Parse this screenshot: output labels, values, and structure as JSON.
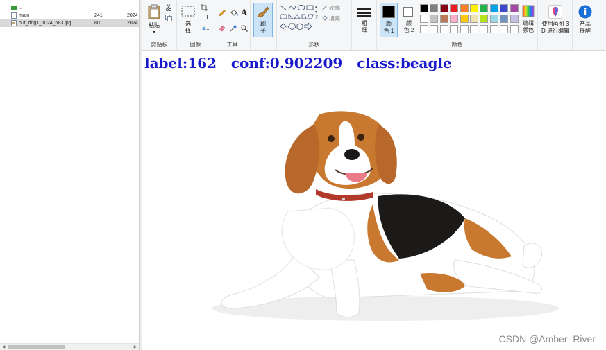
{
  "file_list": {
    "rows": [
      {
        "name": "..",
        "size": "",
        "date": ""
      },
      {
        "name": "main",
        "size": "241",
        "date": "2024"
      },
      {
        "name": "out_dog1_1024_683.jpg",
        "size": "80",
        "date": "2024"
      }
    ]
  },
  "ribbon": {
    "clipboard": {
      "label": "剪贴板",
      "paste": "粘贴"
    },
    "image": {
      "label": "图像",
      "select": "选\n择"
    },
    "tools": {
      "label": "工具"
    },
    "brush": {
      "label": "刷\n子"
    },
    "shapes": {
      "label": "形状",
      "outline": "轮廓",
      "fill": "填充"
    },
    "size": {
      "label": "粗\n细"
    },
    "colors": {
      "label": "颜色",
      "color1_label": "颜\n色 1",
      "color2_label": "颜\n色 2",
      "color1": "#000000",
      "color2": "#ffffff",
      "edit_label": "编辑\n颜色",
      "palette_row1": [
        "#000000",
        "#7f7f7f",
        "#880015",
        "#ed1c24",
        "#ff7f27",
        "#fff200",
        "#22b14c",
        "#00a2e8",
        "#3f48cc",
        "#a349a4"
      ],
      "palette_row2": [
        "#ffffff",
        "#c3c3c3",
        "#b97a57",
        "#ffaec9",
        "#ffc90e",
        "#efe4b0",
        "#b5e61d",
        "#99d9ea",
        "#7092be",
        "#c8bfe7"
      ],
      "palette_row3": [
        "#ffffff",
        "#ffffff",
        "#ffffff",
        "#ffffff",
        "#ffffff",
        "#ffffff",
        "#ffffff",
        "#ffffff",
        "#ffffff",
        "#ffffff"
      ]
    },
    "paint3d": {
      "label": "使用画图 3\nD 进行编辑"
    },
    "product": {
      "label": "产品\n提醒"
    }
  },
  "canvas": {
    "detection_text": "label:162   conf:0.902209   class:beagle",
    "watermark": "CSDN @Amber_River"
  }
}
